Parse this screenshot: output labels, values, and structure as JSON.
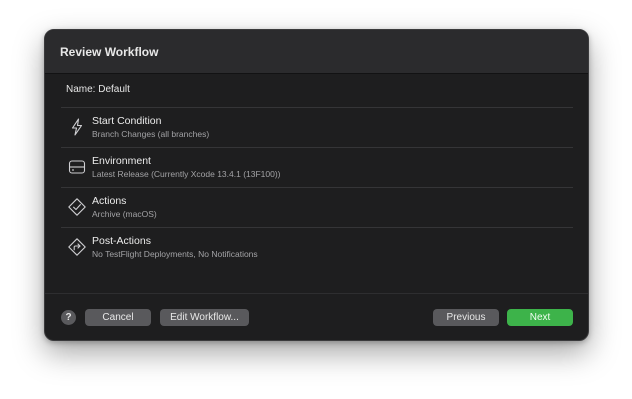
{
  "dialog": {
    "title": "Review Workflow",
    "name_line": "Name: Default"
  },
  "items": [
    {
      "icon": "lightning-bolt-icon",
      "label": "Start Condition",
      "detail": "Branch Changes (all branches)"
    },
    {
      "icon": "server-drive-icon",
      "label": "Environment",
      "detail": "Latest Release (Currently Xcode 13.4.1 (13F100))"
    },
    {
      "icon": "checkmark-diamond-icon",
      "label": "Actions",
      "detail": "Archive (macOS)"
    },
    {
      "icon": "arrow-diamond-icon",
      "label": "Post-Actions",
      "detail": "No TestFlight Deployments, No Notifications"
    }
  ],
  "footer": {
    "help_label": "?",
    "cancel_label": "Cancel",
    "edit_label": "Edit Workflow...",
    "previous_label": "Previous",
    "next_label": "Next"
  },
  "colors": {
    "dialog_bg": "#1e1e1f",
    "header_bg": "#2b2b2d",
    "button_bg": "#59595c",
    "primary_button_bg": "#3db34a"
  }
}
